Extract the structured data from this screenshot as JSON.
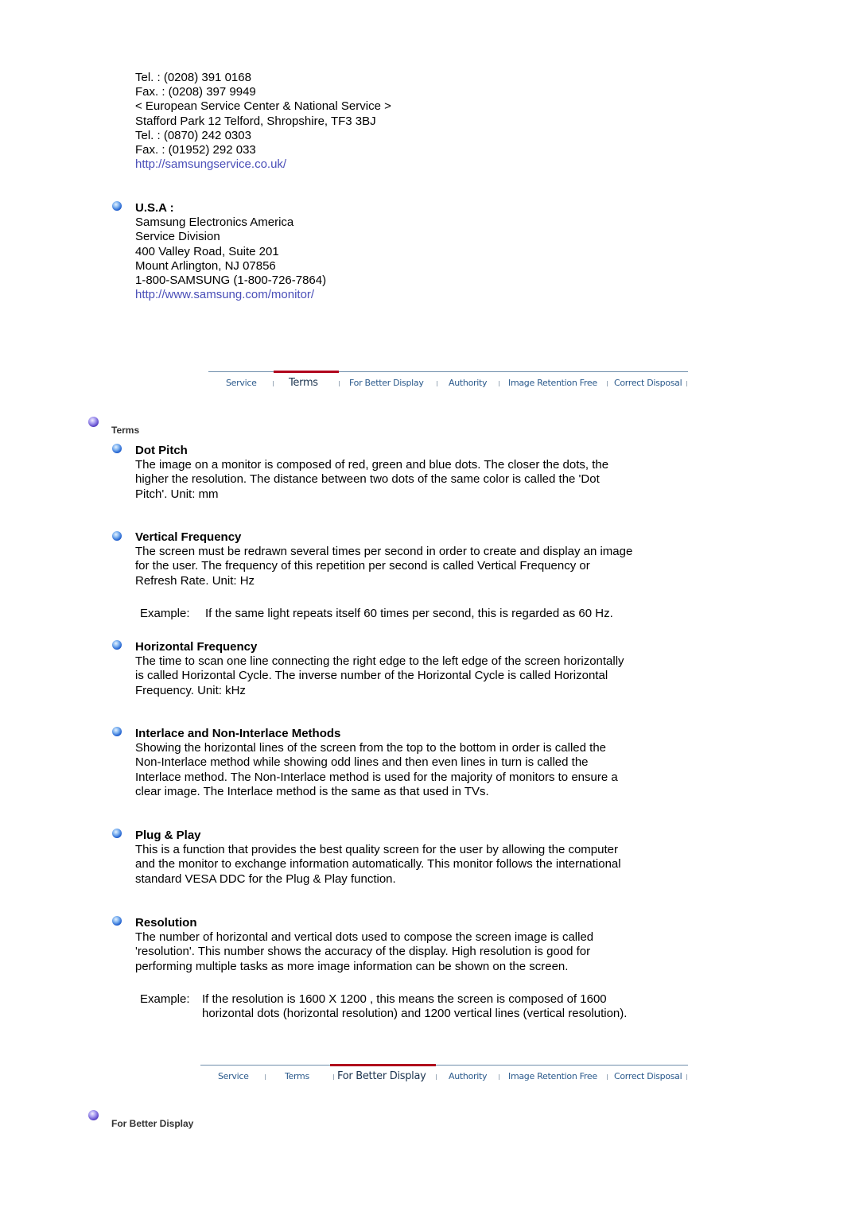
{
  "uk_block": {
    "lines": [
      "Tel. : (0208) 391 0168",
      "Fax. : (0208) 397 9949",
      "< European Service Center & National Service >",
      "Stafford Park 12 Telford, Shropshire, TF3 3BJ",
      "Tel. : (0870) 242 0303",
      "Fax. : (01952) 292 033"
    ],
    "link": "http://samsungservice.co.uk/"
  },
  "usa_block": {
    "heading": "U.S.A :",
    "lines": [
      "Samsung Electronics America",
      "Service Division",
      "400 Valley Road, Suite 201",
      "Mount Arlington, NJ 07856",
      "1-800-SAMSUNG (1-800-726-7864)"
    ],
    "link": "http://www.samsung.com/monitor/"
  },
  "nav_tabs": [
    "Service",
    "Terms",
    "For Better Display",
    "Authority",
    "Image Retention Free",
    "Correct Disposal"
  ],
  "nav1_active": "Terms",
  "nav2_active": "For Better Display",
  "terms_section": {
    "label": "Terms",
    "items": [
      {
        "title": "Dot Pitch",
        "lines": [
          "The image on a monitor is composed of red, green and blue dots. The closer the dots, the",
          "higher the resolution. The distance between two dots of the same color is called the 'Dot",
          "Pitch'. Unit: mm"
        ]
      },
      {
        "title": "Vertical Frequency",
        "lines": [
          "The screen must be redrawn several times per second in order to create and display an image",
          "for the user. The frequency of this repetition per second is called Vertical Frequency or",
          "Refresh Rate. Unit: Hz"
        ],
        "example_label": "Example:",
        "example_lines": [
          "If the same light repeats itself 60 times per second, this is regarded as 60 Hz."
        ]
      },
      {
        "title": "Horizontal Frequency",
        "lines": [
          "The time to scan one line connecting the right edge to the left edge of the screen horizontally",
          "is called Horizontal Cycle. The inverse number of the Horizontal Cycle is called Horizontal",
          "Frequency. Unit: kHz"
        ]
      },
      {
        "title": "Interlace and Non-Interlace Methods",
        "lines": [
          "Showing the horizontal lines of the screen from the top to the bottom in order is called the",
          "Non-Interlace method while showing odd lines and then even lines in turn is called the",
          "Interlace method. The Non-Interlace method is used for the majority of monitors to ensure a",
          "clear image. The Interlace method is the same as that used in TVs."
        ]
      },
      {
        "title": "Plug & Play",
        "lines": [
          "This is a function that provides the best quality screen for the user by allowing the computer",
          "and the monitor to exchange information automatically. This monitor follows the international",
          "standard VESA DDC for the Plug & Play function."
        ]
      },
      {
        "title": "Resolution",
        "lines": [
          "The number of horizontal and vertical dots used to compose the screen image is called",
          "'resolution'. This number shows the accuracy of the display. High resolution is good for",
          "performing multiple tasks as more image information can be shown on the screen."
        ],
        "example_label": "Example:",
        "example_lines": [
          "If the resolution is 1600 X 1200 , this means the screen is composed of 1600",
          "horizontal dots (horizontal resolution) and 1200 vertical lines (vertical resolution)."
        ]
      }
    ]
  },
  "better_display_section": {
    "label": "For Better Display"
  },
  "colors": {
    "link": "#4a4fb8",
    "nav_text": "#2b5a8c",
    "nav_active_bar": "#b0001c"
  }
}
